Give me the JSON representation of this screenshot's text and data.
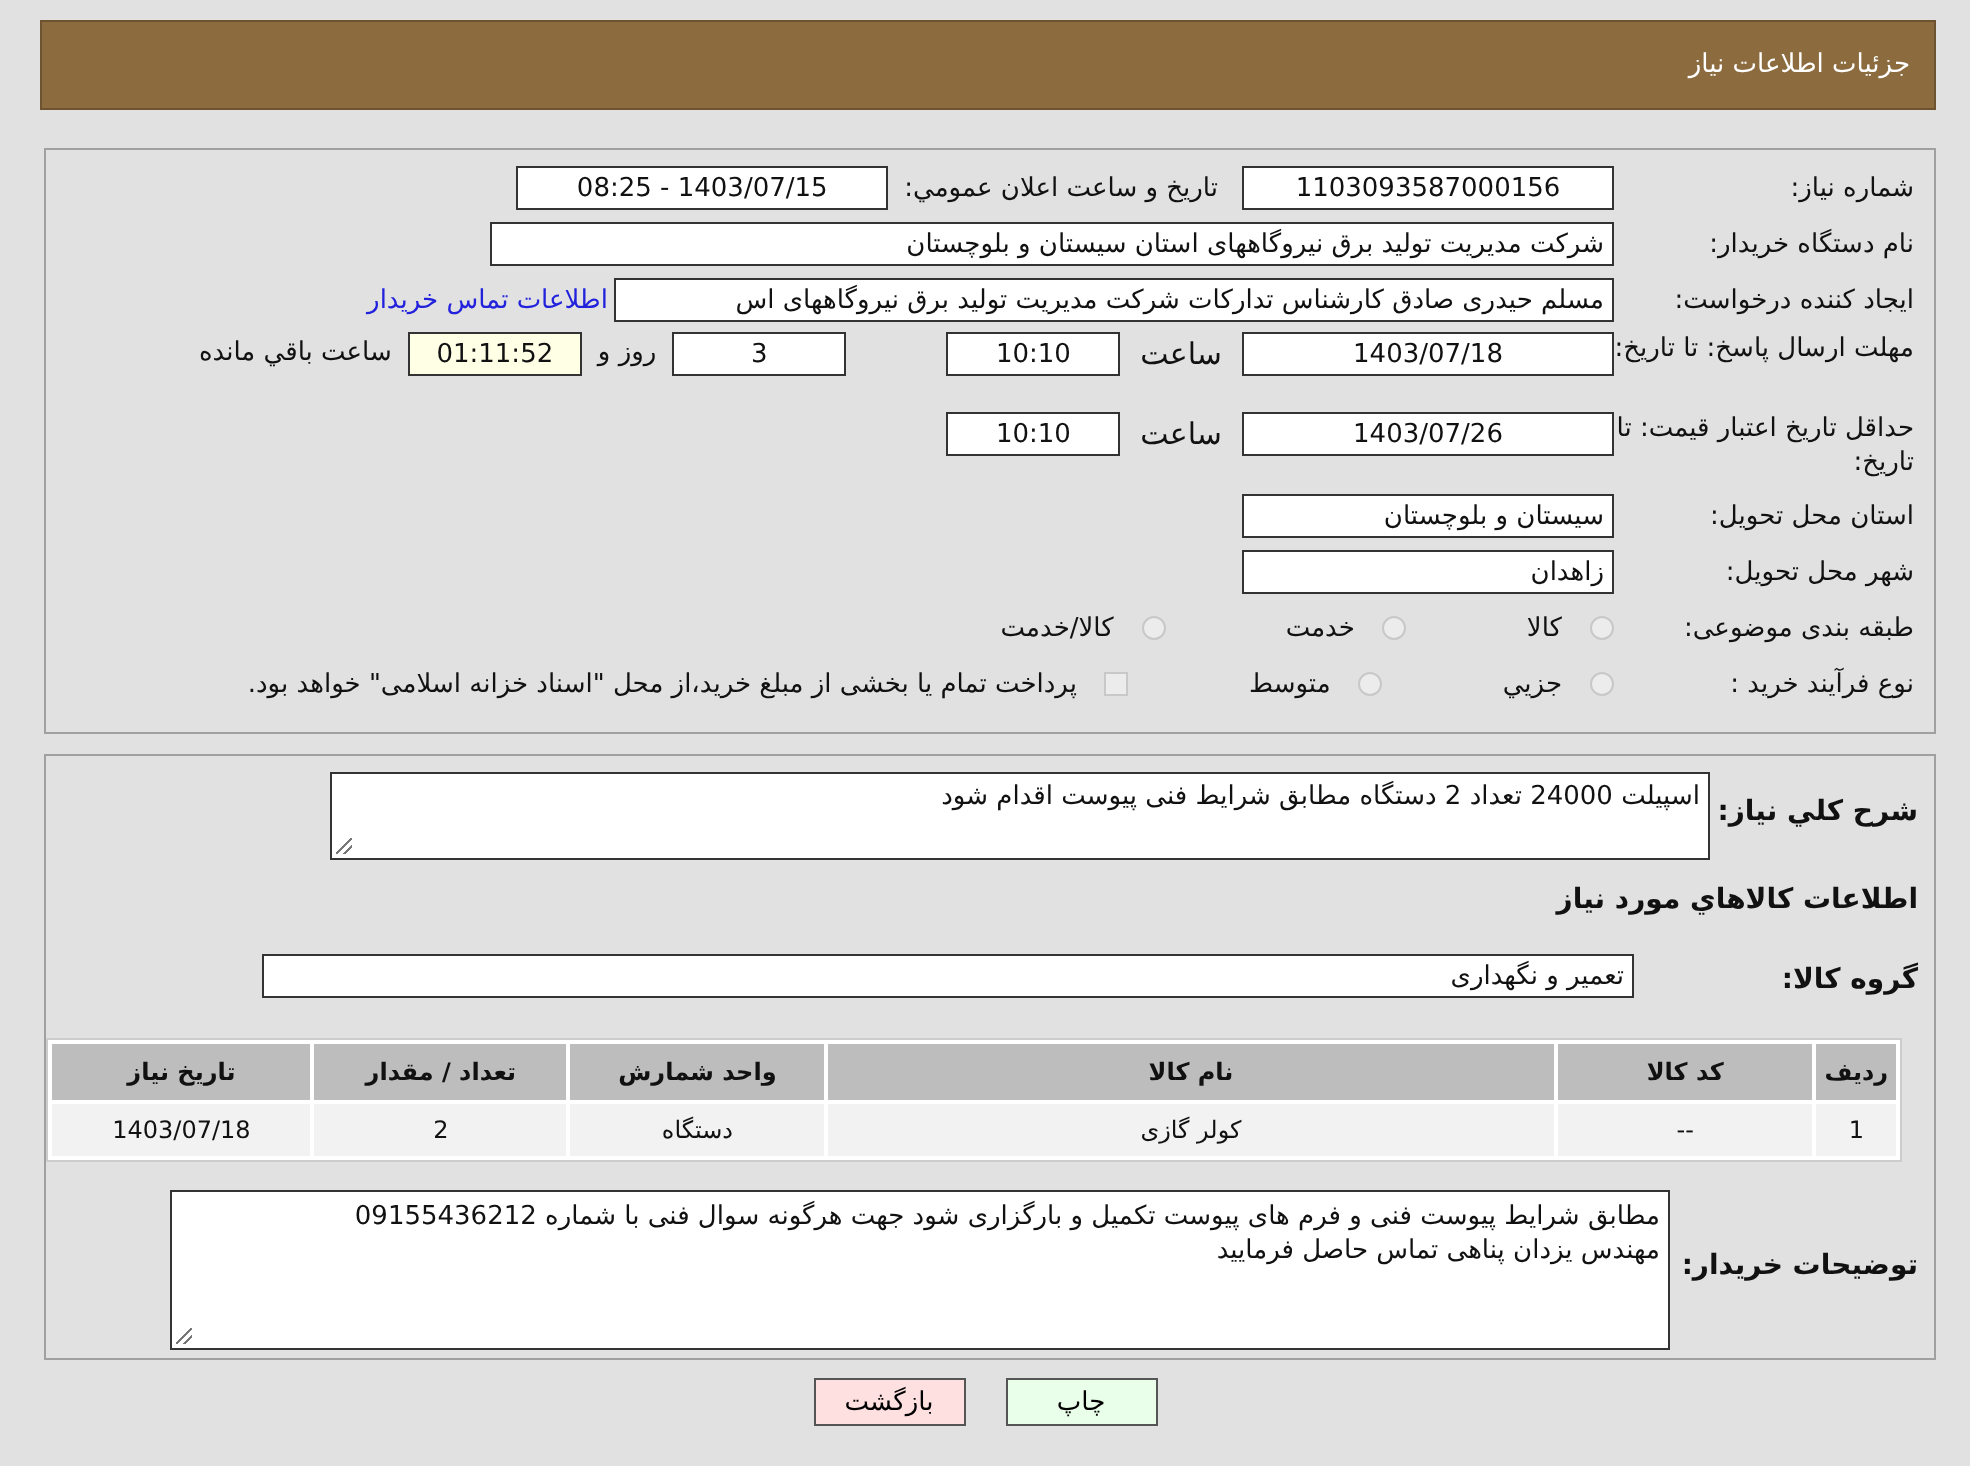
{
  "header": {
    "title": "جزئیات اطلاعات نیاز"
  },
  "details": {
    "need_number": {
      "label": "شماره نیاز:",
      "value": "1103093587000156"
    },
    "announce": {
      "label": "تاریخ و ساعت اعلان عمومي:",
      "value": "1403/07/15 - 08:25"
    },
    "buyer": {
      "label": "نام دستگاه خریدار:",
      "value": "شرکت مدیریت تولید برق نیروگاههای استان سیستان و بلوچستان"
    },
    "creator": {
      "label": "ایجاد کننده درخواست:",
      "value": "مسلم حیدری صادق کارشناس تدارکات شرکت مدیریت تولید برق نیروگاههای اس",
      "link": "اطلاعات تماس خریدار"
    },
    "deadline": {
      "label": "مهلت ارسال پاسخ: تا تاریخ:",
      "date": "1403/07/18",
      "time_label": "ساعت",
      "time": "10:10",
      "days": "3",
      "days_label": "روز و",
      "remaining": "01:11:52",
      "remaining_label": "ساعت باقي مانده"
    },
    "validity": {
      "label": "حداقل تاریخ اعتبار قیمت: تا تاریخ:",
      "date": "1403/07/26",
      "time_label": "ساعت",
      "time": "10:10"
    },
    "province": {
      "label": "استان محل تحویل:",
      "value": "سیستان و بلوچستان"
    },
    "city": {
      "label": "شهر محل تحویل:",
      "value": "زاهدان"
    },
    "category": {
      "label": "طبقه بندی موضوعی:",
      "options": [
        {
          "label": "کالا",
          "selected": false
        },
        {
          "label": "خدمت",
          "selected": false
        },
        {
          "label": "کالا/خدمت",
          "selected": false
        }
      ]
    },
    "purchase_type": {
      "label": "نوع فرآیند خرید :",
      "options": [
        {
          "label": "جزيي",
          "selected": false
        },
        {
          "label": "متوسط",
          "selected": false
        }
      ],
      "treasury": {
        "label": "پرداخت تمام یا بخشی از مبلغ خرید،از محل \"اسناد خزانه اسلامی\" خواهد بود.",
        "checked": false
      }
    }
  },
  "summary": {
    "label": "شرح کلي نیاز:",
    "value": "اسپیلت 24000  تعداد  2 دستگاه مطابق شرایط فنی پیوست اقدام شود"
  },
  "goods": {
    "title": "اطلاعات کالاهاي مورد نیاز",
    "group_label": "گروه کالا:",
    "group": "تعمیر و نگهداری",
    "table": {
      "columns": [
        "ردیف",
        "کد کالا",
        "نام کالا",
        "واحد شمارش",
        "تعداد / مقدار",
        "تاریخ نیاز"
      ],
      "rows": [
        [
          "1",
          "--",
          "کولر گازی",
          "دستگاه",
          "2",
          "1403/07/18"
        ]
      ]
    }
  },
  "notes": {
    "label": "توضیحات خریدار:",
    "lines": [
      "مطابق شرایط پیوست فنی و فرم های پیوست تکمیل و بارگزاری شود جهت هرگونه سوال فنی با شماره 09155436212",
      "مهندس یزدان پناهی تماس حاصل فرمایید"
    ]
  },
  "buttons": [
    {
      "label": "چاپ",
      "kind": "print"
    },
    {
      "label": "بازگشت",
      "kind": "back"
    }
  ]
}
